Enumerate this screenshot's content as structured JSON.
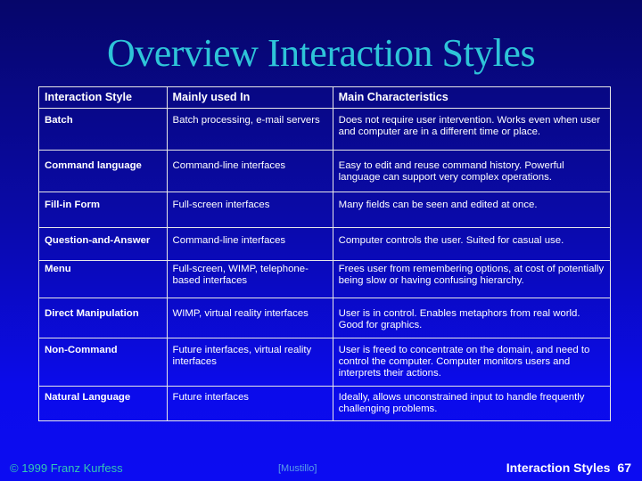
{
  "slide": {
    "title": "Overview Interaction Styles",
    "table": {
      "headers": [
        "Interaction Style",
        "Mainly used In",
        "Main Characteristics"
      ],
      "rows": [
        [
          "Batch",
          "Batch processing, e-mail servers",
          "Does not require user intervention. Works even when user and computer are in a different time or place."
        ],
        [
          "Command language",
          "Command-line interfaces",
          "Easy to edit and reuse command history. Powerful language can support very complex operations."
        ],
        [
          "Fill-in Form",
          "Full-screen interfaces",
          "Many fields can be seen and edited at once."
        ],
        [
          "Question-and-Answer",
          "Command-line interfaces",
          "Computer controls the user. Suited for casual use."
        ],
        [
          "Menu",
          "Full-screen, WIMP, telephone-based interfaces",
          "Frees user from remembering options, at cost of potentially being slow or having confusing hierarchy."
        ],
        [
          "Direct Manipulation",
          "WIMP, virtual reality interfaces",
          "User is in control. Enables metaphors from real world. Good for graphics."
        ],
        [
          "Non-Command",
          "Future interfaces, virtual reality interfaces",
          "User is freed to concentrate on the domain, and need to control the computer. Computer monitors users and interprets their actions."
        ],
        [
          "Natural Language",
          "Future interfaces",
          "Ideally, allows unconstrained input to handle frequently challenging problems."
        ]
      ]
    },
    "footer": {
      "copyright": "© 1999 Franz Kurfess",
      "source": "[Mustillo]",
      "section": "Interaction Styles",
      "page_number": "67"
    },
    "colors": {
      "title": "#2ec4d8",
      "background_top": "#06066a",
      "background_bottom": "#0c0cf2",
      "table_border": "#e8e8e8",
      "copyright": "#33c6b4"
    }
  }
}
